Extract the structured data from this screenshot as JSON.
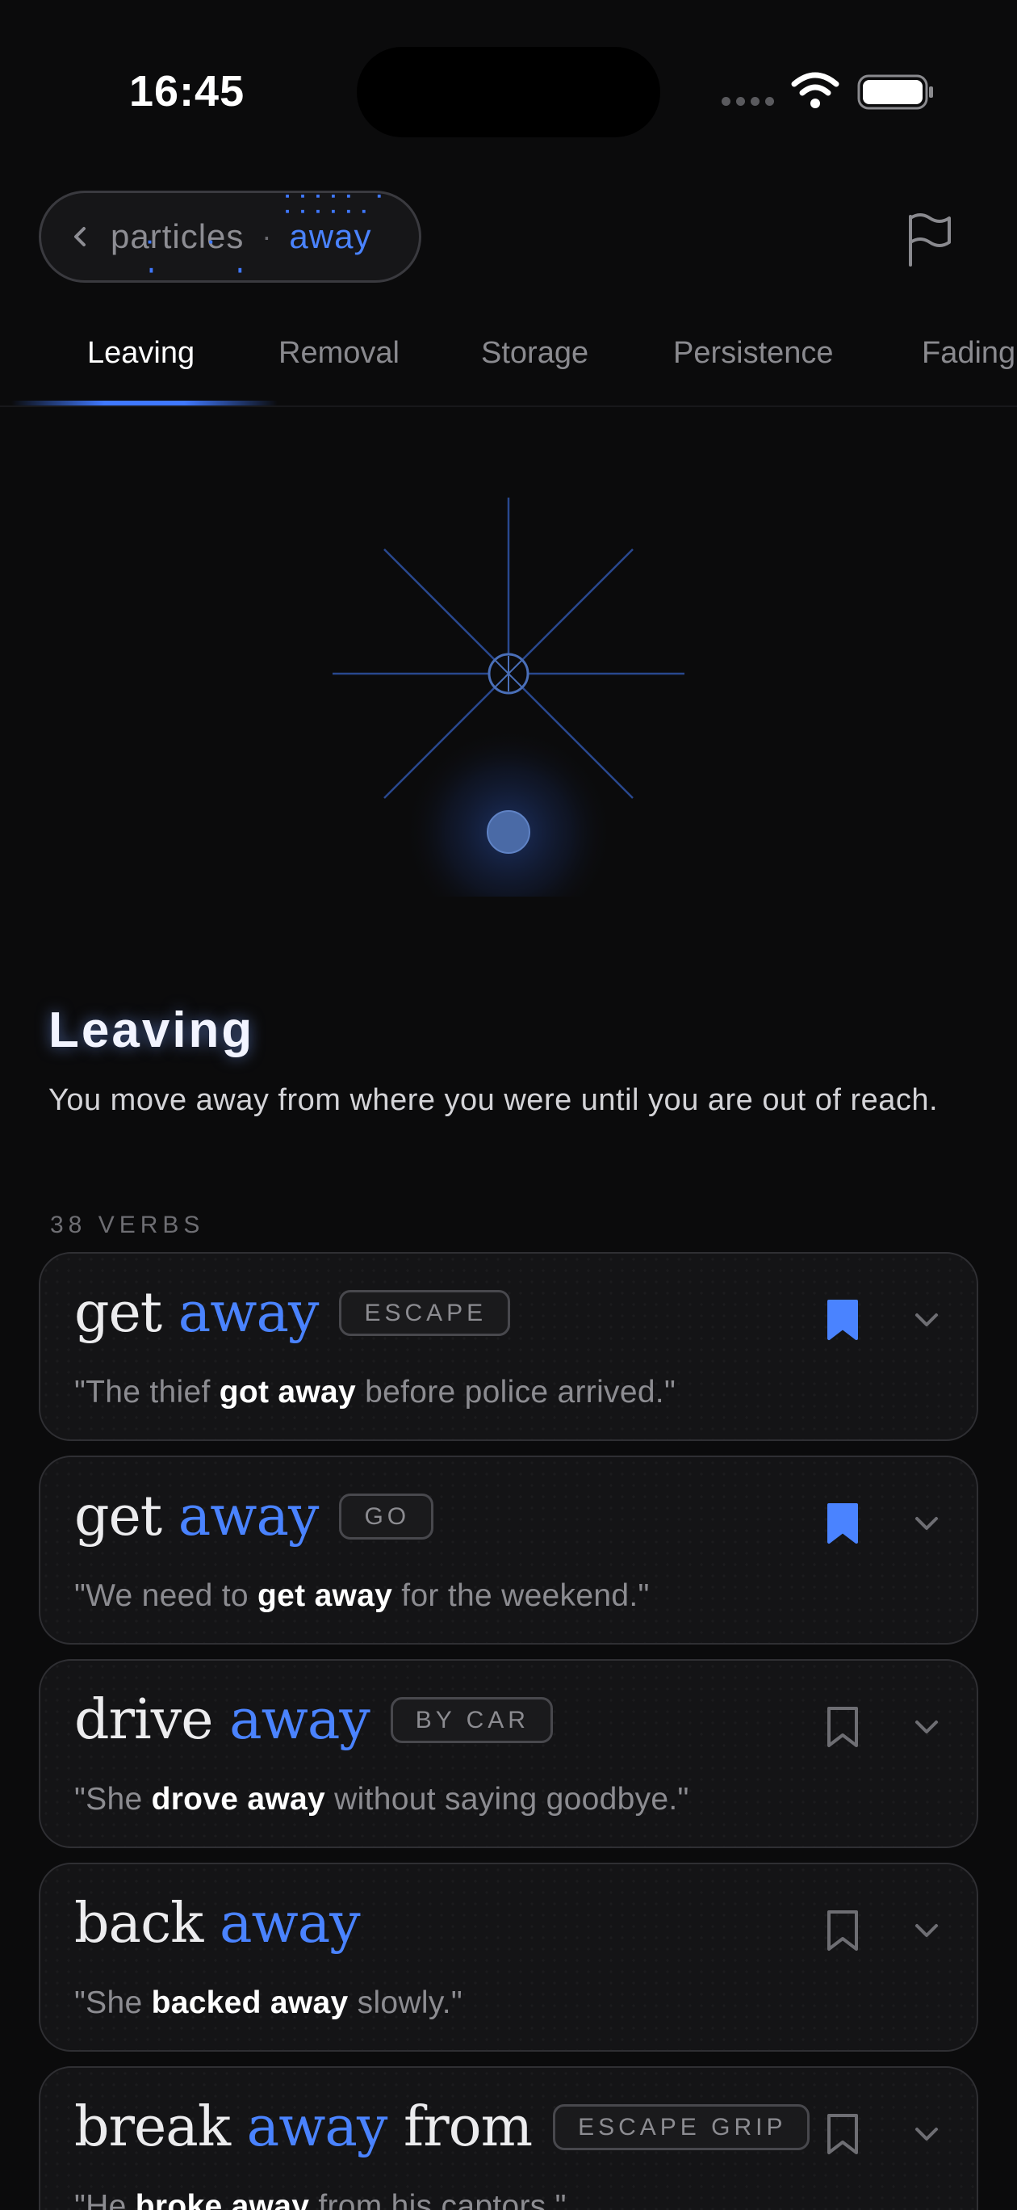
{
  "status_bar": {
    "time": "16:45"
  },
  "breadcrumb": {
    "parent": "particles",
    "separator": "·",
    "current": "away"
  },
  "tabs": [
    {
      "label": "Leaving",
      "active": true
    },
    {
      "label": "Removal",
      "active": false
    },
    {
      "label": "Storage",
      "active": false
    },
    {
      "label": "Persistence",
      "active": false
    },
    {
      "label": "Fading",
      "active": false
    }
  ],
  "section": {
    "title": "Leaving",
    "description": "You move away from where you were until you are out of reach.",
    "verb_count": "38 VERBS"
  },
  "verbs": [
    {
      "verb": "get",
      "particle": "away",
      "extra": "",
      "tag": "ESCAPE",
      "bookmarked": true,
      "ex_pre": "\"The thief ",
      "ex_bold": "got away",
      "ex_post": " before police arrived.\""
    },
    {
      "verb": "get",
      "particle": "away",
      "extra": "",
      "tag": "GO",
      "bookmarked": true,
      "ex_pre": "\"We need to ",
      "ex_bold": "get away",
      "ex_post": " for the weekend.\""
    },
    {
      "verb": "drive",
      "particle": "away",
      "extra": "",
      "tag": "BY CAR",
      "bookmarked": false,
      "ex_pre": "\"She ",
      "ex_bold": "drove away",
      "ex_post": " without saying goodbye.\""
    },
    {
      "verb": "back",
      "particle": "away",
      "extra": "",
      "tag": "",
      "bookmarked": false,
      "ex_pre": "\"She ",
      "ex_bold": "backed away",
      "ex_post": " slowly.\""
    },
    {
      "verb": "break",
      "particle": "away",
      "extra": "from",
      "tag": "ESCAPE GRIP",
      "bookmarked": false,
      "ex_pre": "\"He ",
      "ex_bold": "broke away",
      "ex_post": " from his captors.\""
    }
  ],
  "colors": {
    "accent": "#4a83ff",
    "background": "#0b0b0c",
    "card": "#141416"
  }
}
